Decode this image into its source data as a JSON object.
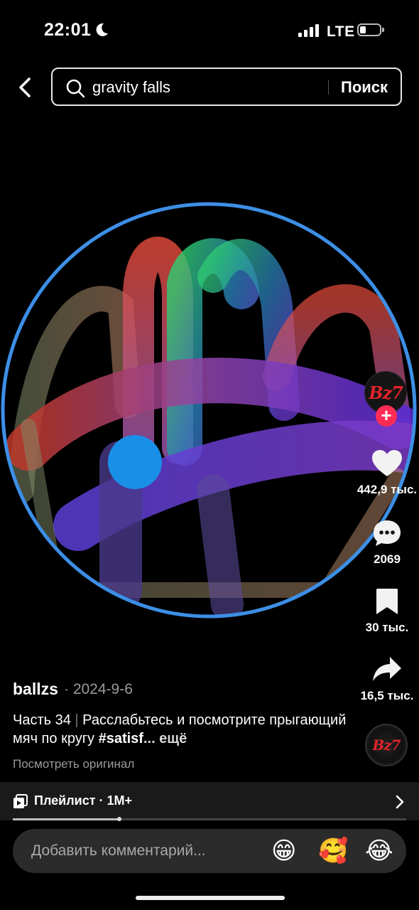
{
  "status_bar": {
    "time": "22:01",
    "network": "LTE",
    "battery_level": 0.3
  },
  "search": {
    "query": "gravity falls",
    "submit_label": "Поиск"
  },
  "rail": {
    "avatar_text": "Bz7",
    "likes": "442,9 тыс.",
    "comments": "2069",
    "saves": "30 тыс.",
    "shares": "16,5 тыс."
  },
  "post": {
    "author": "ballzs",
    "date": "· 2024-9-6",
    "part": "Часть 34",
    "caption_text": "Расслабьтесь и посмотрите прыгающий мяч по кругу ",
    "hashtag": "#satisf",
    "more": "... ещё",
    "view_original": "Посмотреть оригинал"
  },
  "playlist": {
    "label": "Плейлист · 1M+",
    "progress": 0.27
  },
  "comment": {
    "placeholder": "Добавить комментарий...",
    "emojis": [
      "😁",
      "🥰",
      "😂"
    ]
  },
  "colors": {
    "accent": "#fe2c55",
    "ring": "#3d8fe6",
    "ball": "#1a8fe8"
  },
  "icons": [
    "moon-icon",
    "signal-icon",
    "battery-icon",
    "back-icon",
    "search-icon",
    "heart-icon",
    "comment-icon",
    "bookmark-icon",
    "share-icon",
    "playlist-icon",
    "chevron-right-icon"
  ]
}
